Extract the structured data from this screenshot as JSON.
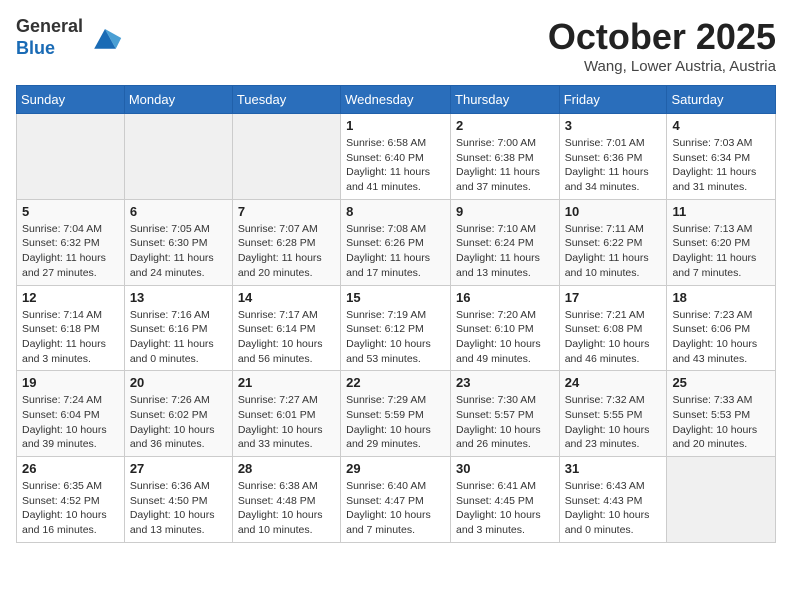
{
  "header": {
    "logo_line1": "General",
    "logo_line2": "Blue",
    "month": "October 2025",
    "location": "Wang, Lower Austria, Austria"
  },
  "weekdays": [
    "Sunday",
    "Monday",
    "Tuesday",
    "Wednesday",
    "Thursday",
    "Friday",
    "Saturday"
  ],
  "weeks": [
    [
      {
        "day": "",
        "info": ""
      },
      {
        "day": "",
        "info": ""
      },
      {
        "day": "",
        "info": ""
      },
      {
        "day": "1",
        "info": "Sunrise: 6:58 AM\nSunset: 6:40 PM\nDaylight: 11 hours\nand 41 minutes."
      },
      {
        "day": "2",
        "info": "Sunrise: 7:00 AM\nSunset: 6:38 PM\nDaylight: 11 hours\nand 37 minutes."
      },
      {
        "day": "3",
        "info": "Sunrise: 7:01 AM\nSunset: 6:36 PM\nDaylight: 11 hours\nand 34 minutes."
      },
      {
        "day": "4",
        "info": "Sunrise: 7:03 AM\nSunset: 6:34 PM\nDaylight: 11 hours\nand 31 minutes."
      }
    ],
    [
      {
        "day": "5",
        "info": "Sunrise: 7:04 AM\nSunset: 6:32 PM\nDaylight: 11 hours\nand 27 minutes."
      },
      {
        "day": "6",
        "info": "Sunrise: 7:05 AM\nSunset: 6:30 PM\nDaylight: 11 hours\nand 24 minutes."
      },
      {
        "day": "7",
        "info": "Sunrise: 7:07 AM\nSunset: 6:28 PM\nDaylight: 11 hours\nand 20 minutes."
      },
      {
        "day": "8",
        "info": "Sunrise: 7:08 AM\nSunset: 6:26 PM\nDaylight: 11 hours\nand 17 minutes."
      },
      {
        "day": "9",
        "info": "Sunrise: 7:10 AM\nSunset: 6:24 PM\nDaylight: 11 hours\nand 13 minutes."
      },
      {
        "day": "10",
        "info": "Sunrise: 7:11 AM\nSunset: 6:22 PM\nDaylight: 11 hours\nand 10 minutes."
      },
      {
        "day": "11",
        "info": "Sunrise: 7:13 AM\nSunset: 6:20 PM\nDaylight: 11 hours\nand 7 minutes."
      }
    ],
    [
      {
        "day": "12",
        "info": "Sunrise: 7:14 AM\nSunset: 6:18 PM\nDaylight: 11 hours\nand 3 minutes."
      },
      {
        "day": "13",
        "info": "Sunrise: 7:16 AM\nSunset: 6:16 PM\nDaylight: 11 hours\nand 0 minutes."
      },
      {
        "day": "14",
        "info": "Sunrise: 7:17 AM\nSunset: 6:14 PM\nDaylight: 10 hours\nand 56 minutes."
      },
      {
        "day": "15",
        "info": "Sunrise: 7:19 AM\nSunset: 6:12 PM\nDaylight: 10 hours\nand 53 minutes."
      },
      {
        "day": "16",
        "info": "Sunrise: 7:20 AM\nSunset: 6:10 PM\nDaylight: 10 hours\nand 49 minutes."
      },
      {
        "day": "17",
        "info": "Sunrise: 7:21 AM\nSunset: 6:08 PM\nDaylight: 10 hours\nand 46 minutes."
      },
      {
        "day": "18",
        "info": "Sunrise: 7:23 AM\nSunset: 6:06 PM\nDaylight: 10 hours\nand 43 minutes."
      }
    ],
    [
      {
        "day": "19",
        "info": "Sunrise: 7:24 AM\nSunset: 6:04 PM\nDaylight: 10 hours\nand 39 minutes."
      },
      {
        "day": "20",
        "info": "Sunrise: 7:26 AM\nSunset: 6:02 PM\nDaylight: 10 hours\nand 36 minutes."
      },
      {
        "day": "21",
        "info": "Sunrise: 7:27 AM\nSunset: 6:01 PM\nDaylight: 10 hours\nand 33 minutes."
      },
      {
        "day": "22",
        "info": "Sunrise: 7:29 AM\nSunset: 5:59 PM\nDaylight: 10 hours\nand 29 minutes."
      },
      {
        "day": "23",
        "info": "Sunrise: 7:30 AM\nSunset: 5:57 PM\nDaylight: 10 hours\nand 26 minutes."
      },
      {
        "day": "24",
        "info": "Sunrise: 7:32 AM\nSunset: 5:55 PM\nDaylight: 10 hours\nand 23 minutes."
      },
      {
        "day": "25",
        "info": "Sunrise: 7:33 AM\nSunset: 5:53 PM\nDaylight: 10 hours\nand 20 minutes."
      }
    ],
    [
      {
        "day": "26",
        "info": "Sunrise: 6:35 AM\nSunset: 4:52 PM\nDaylight: 10 hours\nand 16 minutes."
      },
      {
        "day": "27",
        "info": "Sunrise: 6:36 AM\nSunset: 4:50 PM\nDaylight: 10 hours\nand 13 minutes."
      },
      {
        "day": "28",
        "info": "Sunrise: 6:38 AM\nSunset: 4:48 PM\nDaylight: 10 hours\nand 10 minutes."
      },
      {
        "day": "29",
        "info": "Sunrise: 6:40 AM\nSunset: 4:47 PM\nDaylight: 10 hours\nand 7 minutes."
      },
      {
        "day": "30",
        "info": "Sunrise: 6:41 AM\nSunset: 4:45 PM\nDaylight: 10 hours\nand 3 minutes."
      },
      {
        "day": "31",
        "info": "Sunrise: 6:43 AM\nSunset: 4:43 PM\nDaylight: 10 hours\nand 0 minutes."
      },
      {
        "day": "",
        "info": ""
      }
    ]
  ]
}
